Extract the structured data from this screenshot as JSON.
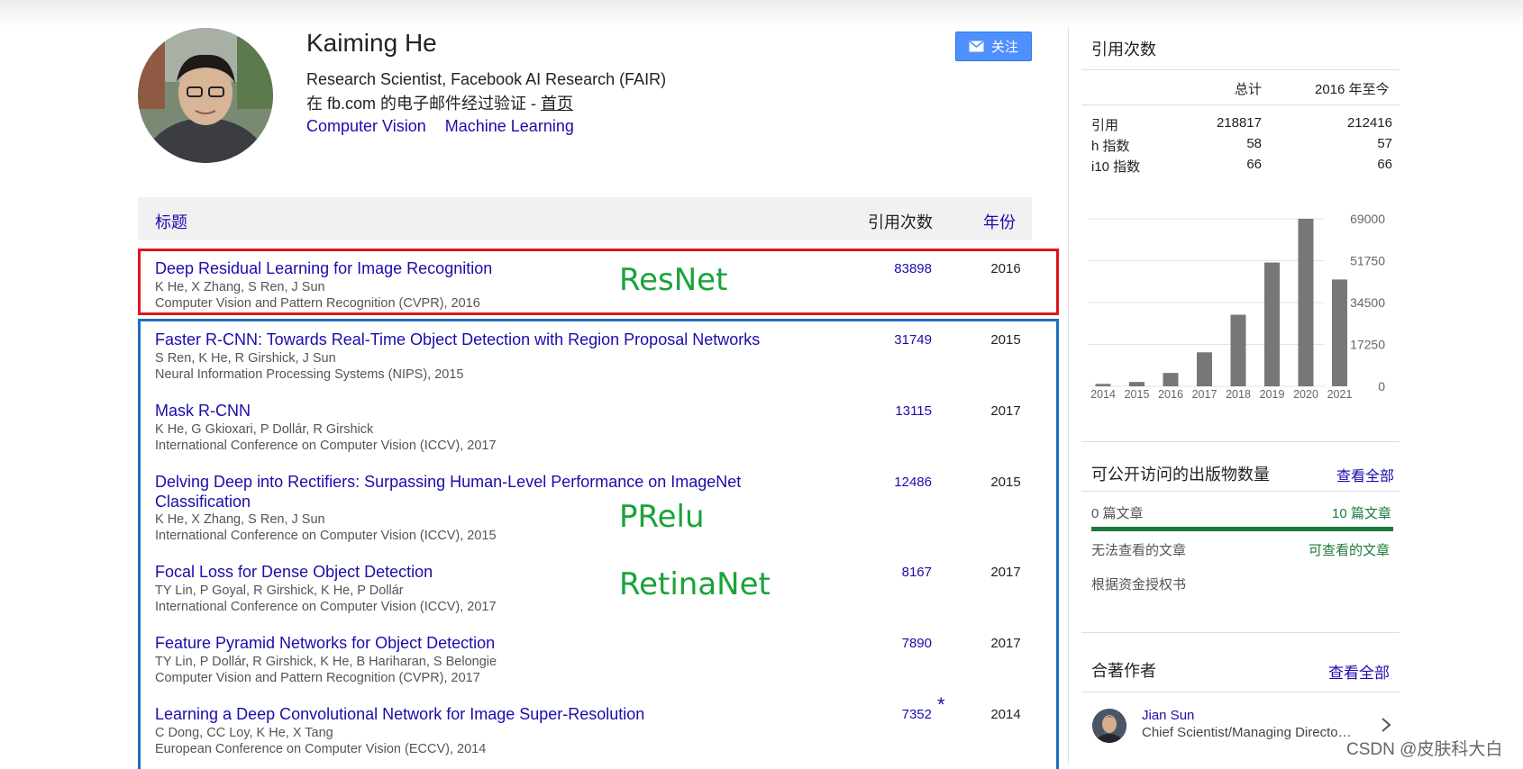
{
  "profile": {
    "name": "Kaiming He",
    "affiliation": "Research Scientist, Facebook AI Research (FAIR)",
    "email_text": "在 fb.com 的电子邮件经过验证 - ",
    "homepage_label": "首页",
    "interests": [
      "Computer Vision",
      "Machine Learning"
    ],
    "follow_label": "关注"
  },
  "table": {
    "header_title": "标题",
    "header_cites": "引用次数",
    "header_year": "年份",
    "papers": [
      {
        "title": "Deep Residual Learning for Image Recognition",
        "authors": "K He, X Zhang, S Ren, J Sun",
        "venue": "Computer Vision and Pattern Recognition (CVPR), 2016",
        "cites": "83898",
        "year": "2016"
      },
      {
        "title": "Faster R-CNN: Towards Real-Time Object Detection with Region Proposal Networks",
        "authors": "S Ren, K He, R Girshick, J Sun",
        "venue": "Neural Information Processing Systems (NIPS), 2015",
        "cites": "31749",
        "year": "2015"
      },
      {
        "title": "Mask R-CNN",
        "authors": "K He, G Gkioxari, P Dollár, R Girshick",
        "venue": "International Conference on Computer Vision (ICCV), 2017",
        "cites": "13115",
        "year": "2017"
      },
      {
        "title": "Delving Deep into Rectifiers: Surpassing Human-Level Performance on ImageNet Classification",
        "authors": "K He, X Zhang, S Ren, J Sun",
        "venue": "International Conference on Computer Vision (ICCV), 2015",
        "cites": "12486",
        "year": "2015"
      },
      {
        "title": "Focal Loss for Dense Object Detection",
        "authors": "TY Lin, P Goyal, R Girshick, K He, P Dollár",
        "venue": "International Conference on Computer Vision (ICCV), 2017",
        "cites": "8167",
        "year": "2017"
      },
      {
        "title": "Feature Pyramid Networks for Object Detection",
        "authors": "TY Lin, P Dollár, R Girshick, K He, B Hariharan, S Belongie",
        "venue": "Computer Vision and Pattern Recognition (CVPR), 2017",
        "cites": "7890",
        "year": "2017"
      },
      {
        "title": "Learning a Deep Convolutional Network for Image Super-Resolution",
        "authors": "C Dong, CC Loy, K He, X Tang",
        "venue": "European Conference on Computer Vision (ECCV), 2014",
        "cites": "7352",
        "cite_mark": "*",
        "year": "2014"
      }
    ]
  },
  "annotations": {
    "resnet": "ResNet",
    "prelu": "PRelu",
    "retinanet": "RetinaNet",
    "red_box_color": "#e0151b",
    "blue_box_color": "#1e6fc0",
    "annotation_color": "#1aa339"
  },
  "citations": {
    "title": "引用次数",
    "col_total": "总计",
    "col_since": "2016 年至今",
    "rows": [
      {
        "label": "引用",
        "total": "218817",
        "since": "212416"
      },
      {
        "label": "h 指数",
        "total": "58",
        "since": "57"
      },
      {
        "label": "i10 指数",
        "total": "66",
        "since": "66"
      }
    ]
  },
  "chart_data": {
    "type": "bar",
    "categories": [
      "2014",
      "2015",
      "2016",
      "2017",
      "2018",
      "2019",
      "2020",
      "2021"
    ],
    "values": [
      1000,
      1800,
      5500,
      14000,
      29500,
      51000,
      69000,
      44000
    ],
    "ytick_labels": [
      "69000",
      "51750",
      "34500",
      "17250",
      "0"
    ],
    "ylim": [
      0,
      69000
    ],
    "grid": true,
    "bar_color": "#777777"
  },
  "open_access": {
    "title": "可公开访问的出版物数量",
    "view_all": "查看全部",
    "left_count": "0 篇文章",
    "right_count": "10 篇文章",
    "left_label": "无法查看的文章",
    "right_label": "可查看的文章",
    "mandates": "根据资金授权书"
  },
  "coauthors": {
    "title": "合著作者",
    "view_all": "查看全部",
    "items": [
      {
        "name": "Jian Sun",
        "role": "Chief Scientist/Managing Directo…"
      }
    ]
  },
  "watermark": "CSDN @皮肤科大白"
}
